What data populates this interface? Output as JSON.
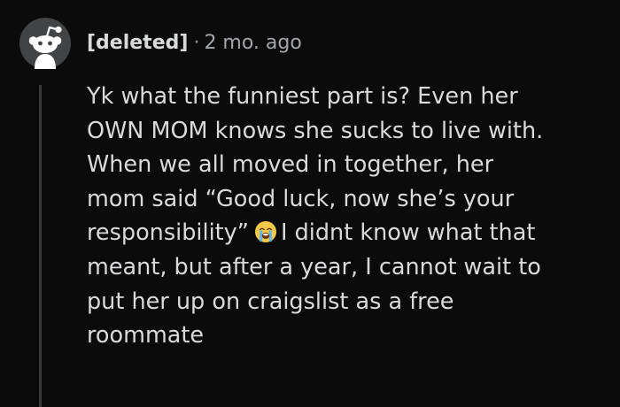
{
  "comment": {
    "author": "[deleted]",
    "separator": "·",
    "timestamp": "2 mo. ago",
    "avatar_icon": "reddit-snoo-avatar-icon",
    "body_lines": [
      "Yk what the funniest part is? Even her",
      "OWN MOM knows she sucks to live with.",
      "When we all moved in together, her",
      "mom said “Good luck, now she’s your"
    ],
    "line5_before_emoji": "responsibility”",
    "emoji_icon": "loudly-crying-face-icon",
    "line5_after_emoji": "I didnt know what that",
    "body_lines_end": [
      "meant, but after a year, I cannot wait to",
      "put her up on craigslist as a free",
      "roommate"
    ]
  },
  "colors": {
    "background": "#0b0b0b",
    "text": "#d8dadc",
    "meta_text": "#a3a6aa",
    "thread_line": "#3a3a3c",
    "avatar_bg": "#414345"
  }
}
